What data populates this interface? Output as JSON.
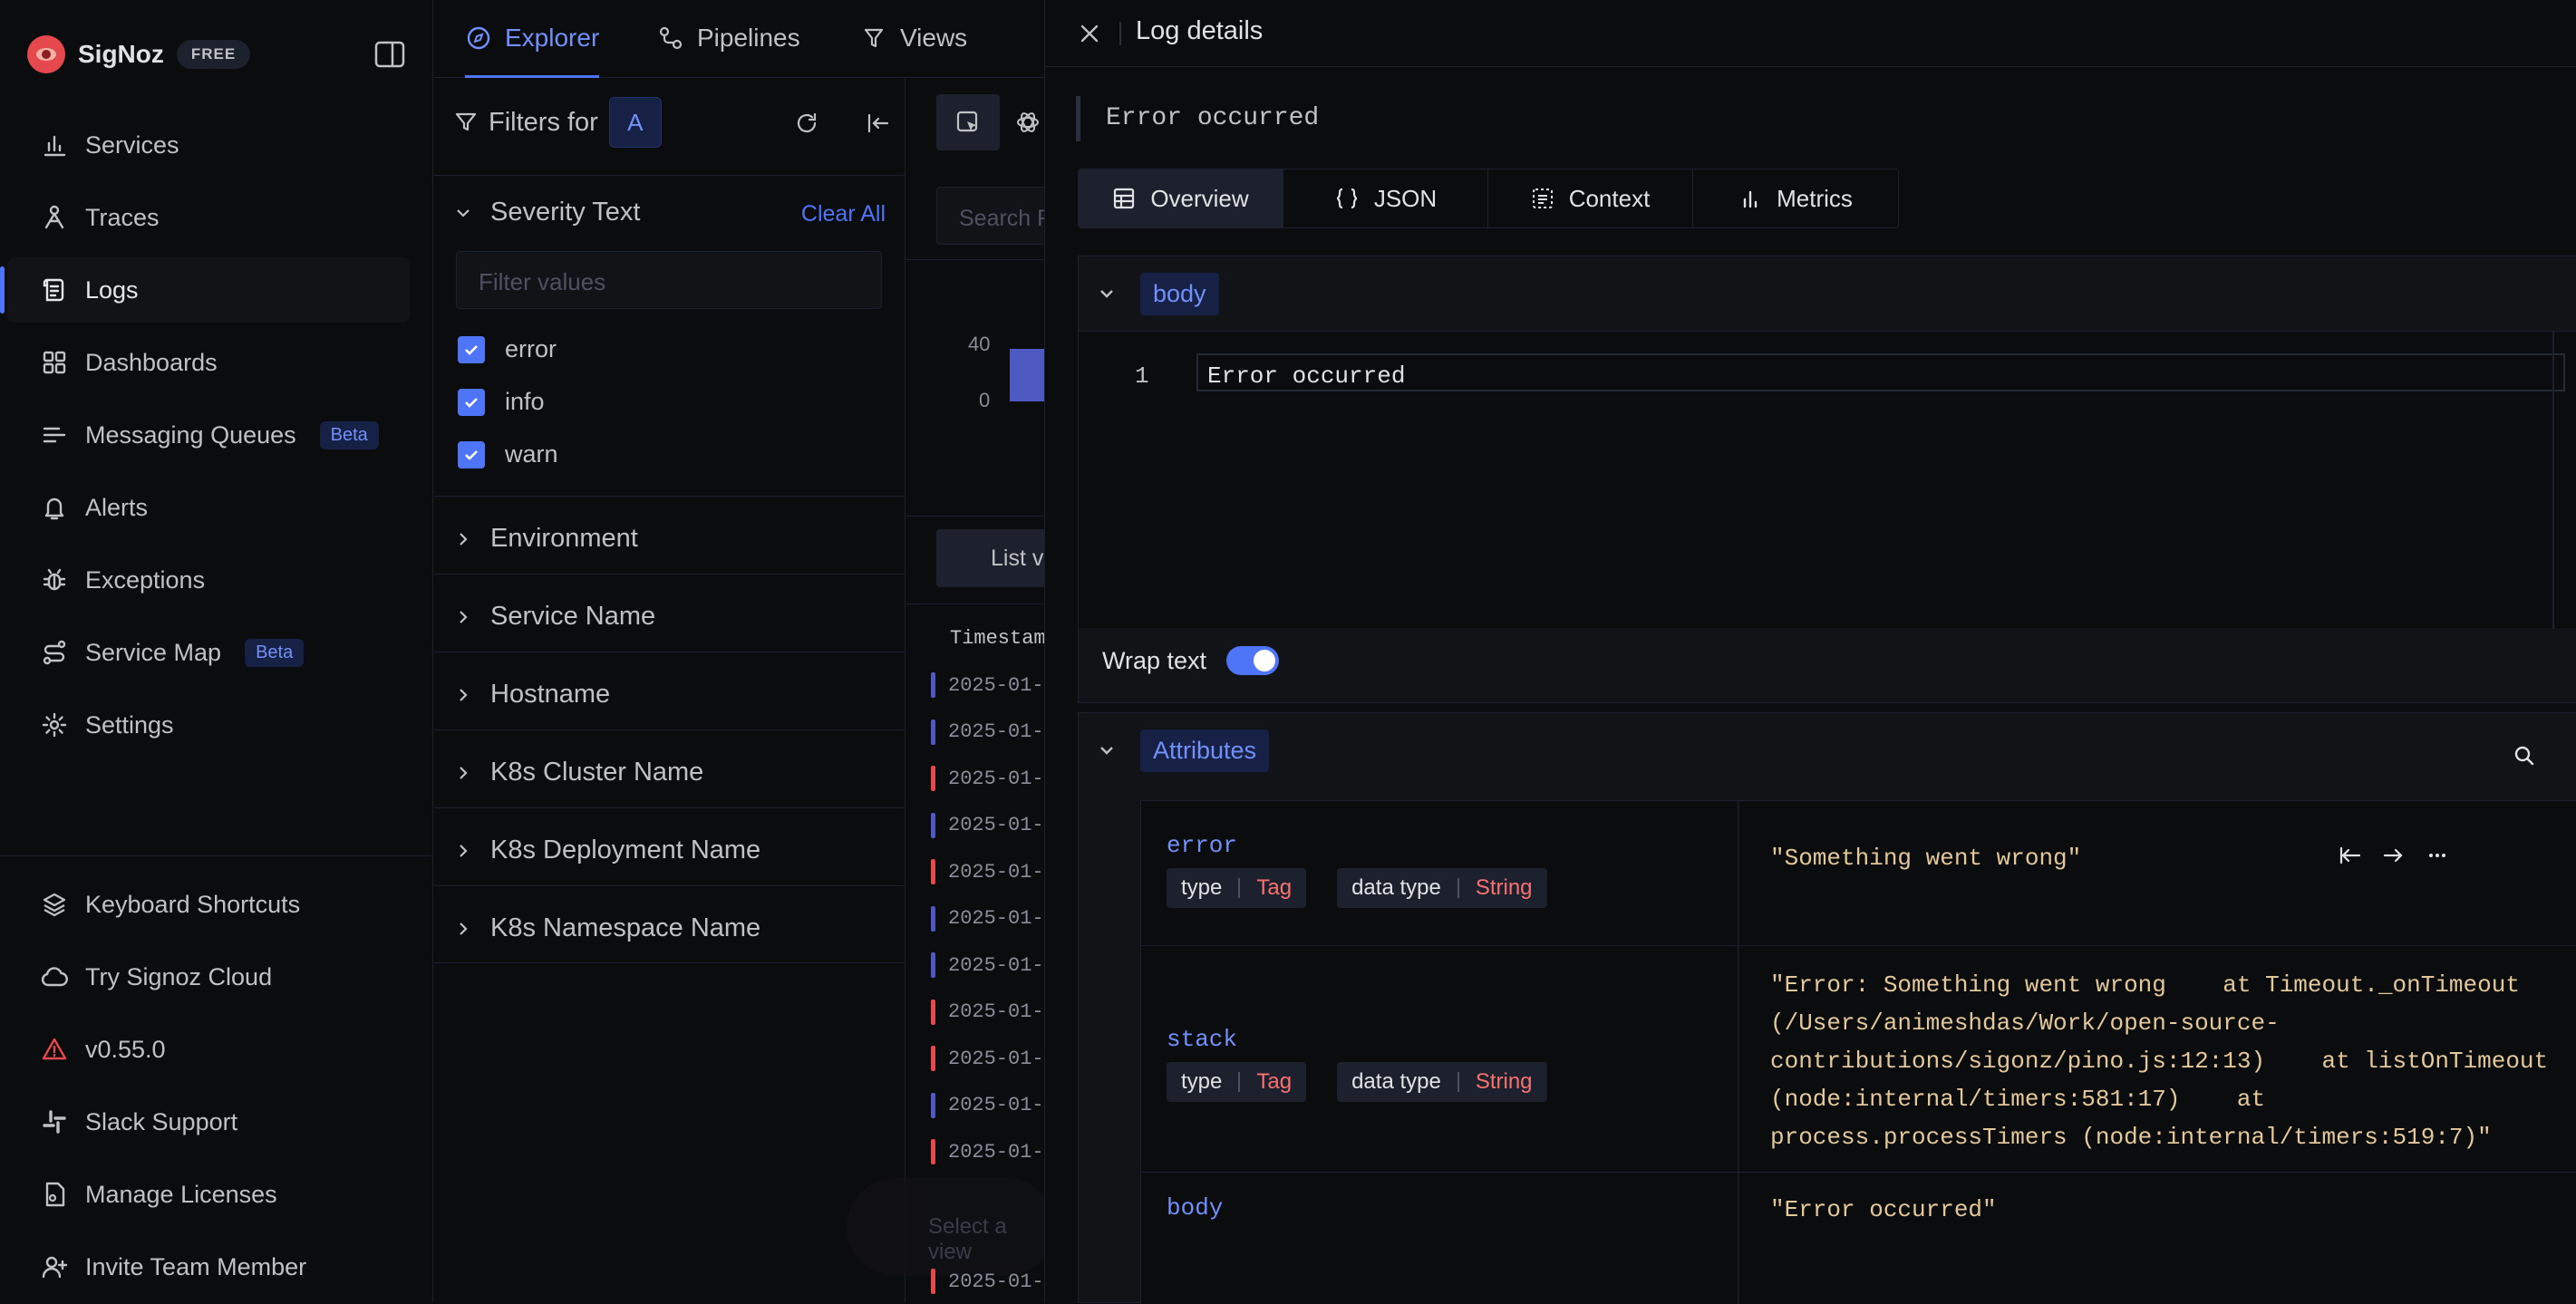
{
  "brand": {
    "name": "SigNoz",
    "badge": "FREE"
  },
  "sidebar": {
    "items": [
      {
        "label": "Services",
        "icon": "bar-chart-icon"
      },
      {
        "label": "Traces",
        "icon": "traces-icon"
      },
      {
        "label": "Logs",
        "icon": "logs-icon",
        "active": true
      },
      {
        "label": "Dashboards",
        "icon": "dashboards-icon"
      },
      {
        "label": "Messaging Queues",
        "icon": "queue-icon",
        "badge": "Beta"
      },
      {
        "label": "Alerts",
        "icon": "bell-icon"
      },
      {
        "label": "Exceptions",
        "icon": "bug-icon"
      },
      {
        "label": "Service Map",
        "icon": "route-icon",
        "badge": "Beta"
      },
      {
        "label": "Settings",
        "icon": "gear-icon"
      }
    ],
    "bottom": [
      {
        "label": "Keyboard Shortcuts",
        "icon": "layers-icon"
      },
      {
        "label": "Try Signoz Cloud",
        "icon": "cloud-icon"
      },
      {
        "label": "v0.55.0",
        "icon": "warning-icon"
      },
      {
        "label": "Slack Support",
        "icon": "slack-icon"
      },
      {
        "label": "Manage Licenses",
        "icon": "license-icon"
      },
      {
        "label": "Invite Team Member",
        "icon": "user-plus-icon"
      }
    ]
  },
  "explorer": {
    "tabs": [
      "Explorer",
      "Pipelines",
      "Views"
    ],
    "filters_label": "Filters for",
    "query_name": "A",
    "severity_section": "Severity Text",
    "clear_all": "Clear All",
    "filter_placeholder": "Filter values",
    "severity_values": [
      "error",
      "info",
      "warn"
    ],
    "sections": [
      "Environment",
      "Service Name",
      "Hostname",
      "K8s Cluster Name",
      "K8s Deployment Name",
      "K8s Namespace Name"
    ],
    "search_placeholder": "Search F",
    "y_ticks": [
      "40",
      "0"
    ],
    "list_view": "List v",
    "timestamp_header": "Timestam",
    "log_rows": [
      {
        "ts": "2025-01-1",
        "level": "info"
      },
      {
        "ts": "2025-01-1",
        "level": "info"
      },
      {
        "ts": "2025-01-1",
        "level": "error"
      },
      {
        "ts": "2025-01-1",
        "level": "info"
      },
      {
        "ts": "2025-01-1",
        "level": "error"
      },
      {
        "ts": "2025-01-1",
        "level": "info"
      },
      {
        "ts": "2025-01-1",
        "level": "info"
      },
      {
        "ts": "2025-01-1",
        "level": "error"
      },
      {
        "ts": "2025-01-1",
        "level": "error"
      },
      {
        "ts": "2025-01-1",
        "level": "info"
      },
      {
        "ts": "2025-01-1",
        "level": "error"
      }
    ],
    "last_log_ts": "2025-01-1",
    "select_view": "Select a view"
  },
  "drawer": {
    "title": "Log details",
    "preview": "Error occurred",
    "tabs": [
      {
        "label": "Overview",
        "icon": "table-icon",
        "active": true
      },
      {
        "label": "JSON",
        "icon": "braces-icon"
      },
      {
        "label": "Context",
        "icon": "context-icon"
      },
      {
        "label": "Metrics",
        "icon": "metrics-icon"
      }
    ],
    "body_section": "body",
    "body_line_number": "1",
    "body_text": "Error occurred",
    "wrap_text_label": "Wrap text",
    "wrap_text_on": true,
    "attributes_section": "Attributes",
    "attributes": [
      {
        "key": "error",
        "type_label": "type",
        "type": "Tag",
        "dtype_label": "data type",
        "dtype": "String",
        "value": "\"Something went wrong\""
      },
      {
        "key": "stack",
        "type_label": "type",
        "type": "Tag",
        "dtype_label": "data type",
        "dtype": "String",
        "value": "\"Error: Something went wrong    at Timeout._onTimeout (/Users/animeshdas/Work/open-source-contributions/sigonz/pino.js:12:13)    at listOnTimeout (node:internal/timers:581:17)    at process.processTimers (node:internal/timers:519:7)\""
      },
      {
        "key": "body",
        "value": "\"Error occurred\""
      }
    ]
  },
  "colors": {
    "accent": "#4e74f8",
    "error": "#e5484d",
    "tag": "#f87171",
    "value": "#e4c89a"
  }
}
